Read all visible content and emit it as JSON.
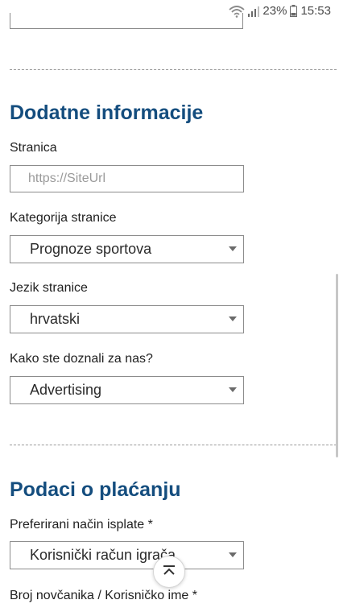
{
  "status_bar": {
    "battery": "23%",
    "time": "15:53",
    "icons": [
      "wifi-icon",
      "signal-icon",
      "battery-icon"
    ]
  },
  "sections": {
    "additional_info": {
      "title": "Dodatne informacije",
      "site_label": "Stranica",
      "site_placeholder": "https://SiteUrl",
      "category_label": "Kategorija stranice",
      "category_value": "Prognoze sportova",
      "language_label": "Jezik stranice",
      "language_value": "hrvatski",
      "referral_label": "Kako ste doznali za nas?",
      "referral_value": "Advertising"
    },
    "payment": {
      "title": "Podaci o plaćanju",
      "method_label": "Preferirani način isplate *",
      "method_value": "Korisnički račun igrača",
      "wallet_label": "Broj novčanika / Korisničko ime *"
    }
  },
  "colors": {
    "heading": "#144d7e",
    "border": "#8c8c8c",
    "divider": "#9a9a9a"
  },
  "scroll_top_icon": "chevron-up-icon"
}
